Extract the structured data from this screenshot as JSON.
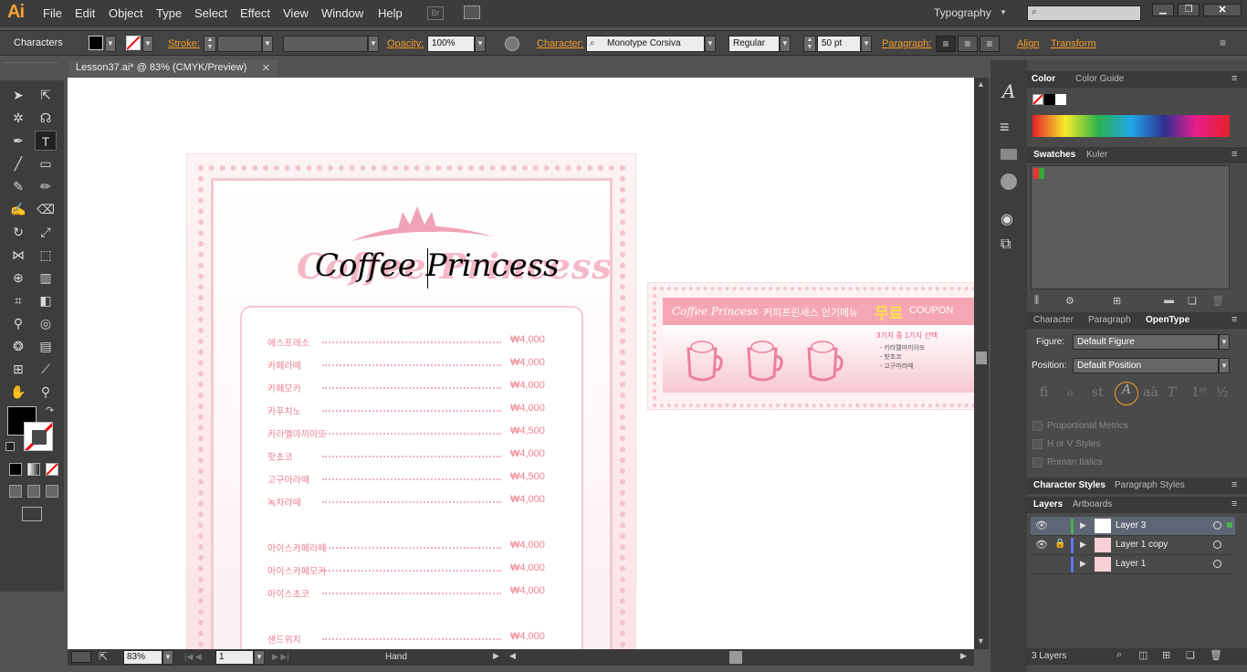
{
  "app": {
    "logo": "Ai",
    "workspace": "Typography"
  },
  "menu": [
    "File",
    "Edit",
    "Object",
    "Type",
    "Select",
    "Effect",
    "View",
    "Window",
    "Help"
  ],
  "control": {
    "panel_label": "Characters",
    "stroke_label": "Stroke:",
    "opacity_label": "Opacity:",
    "opacity_value": "100%",
    "character_label": "Character:",
    "font_name": "Monotype Corsiva",
    "font_style": "Regular",
    "font_size": "50 pt",
    "paragraph_label": "Paragraph:",
    "align_label": "Align",
    "transform_label": "Transform"
  },
  "document": {
    "tab_title": "Lesson37.ai* @ 83% (CMYK/Preview)"
  },
  "artwork": {
    "title_shadow": "Coffee Princess",
    "title_text": "Coffee Princess",
    "menu_items": [
      {
        "name": "에스프레소",
        "price": "₩4,000"
      },
      {
        "name": "카페라떼",
        "price": "₩4,000"
      },
      {
        "name": "카페모카",
        "price": "₩4,000"
      },
      {
        "name": "카푸치노",
        "price": "₩4,000"
      },
      {
        "name": "카라멜마끼아또",
        "price": "₩4,500"
      },
      {
        "name": "핫초코",
        "price": "₩4,000"
      },
      {
        "name": "고구마라떼",
        "price": "₩4,500"
      },
      {
        "name": "녹차라떼",
        "price": "₩4,000"
      },
      {
        "name": "아이스카페라떼",
        "price": "₩4,000"
      },
      {
        "name": "아이스카페모카",
        "price": "₩4,000"
      },
      {
        "name": "아이스초코",
        "price": "₩4,000"
      },
      {
        "name": "샌드위치",
        "price": "₩4,000"
      }
    ],
    "coupon": {
      "logo": "Coffee Princess",
      "headline_pre": "커피프린세스 인기메뉴",
      "headline_free": "무료",
      "headline_post": "COUPON",
      "offer_line": "3가지 중 1가지 선택",
      "options": [
        "- 카라멜마끼아또",
        "- 핫초코",
        "- 고구마라떼"
      ]
    }
  },
  "status": {
    "zoom": "83%",
    "artboard": "1",
    "tool": "Hand"
  },
  "panels": {
    "color_tabs": [
      "Color",
      "Color Guide"
    ],
    "swatches_tabs": [
      "Swatches",
      "Kuler"
    ],
    "type_tabs": [
      "Character",
      "Paragraph",
      "OpenType"
    ],
    "figure_label": "Figure:",
    "figure_value": "Default Figure",
    "position_label": "Position:",
    "position_value": "Default Position",
    "checkboxes": [
      "Proportional Metrics",
      "H or V Styles",
      "Roman Italics"
    ],
    "style_tabs": [
      "Character Styles",
      "Paragraph Styles"
    ],
    "layer_tabs": [
      "Layers",
      "Artboards"
    ],
    "layers": [
      "Layer 3",
      "Layer 1 copy",
      "Layer 1"
    ],
    "layers_count": "3 Layers"
  },
  "colors": {
    "accent": "#f19b2c",
    "pink": "#f07f8d",
    "canvas_bg": "#ffffff",
    "ui_dark": "#3c3c3c"
  }
}
